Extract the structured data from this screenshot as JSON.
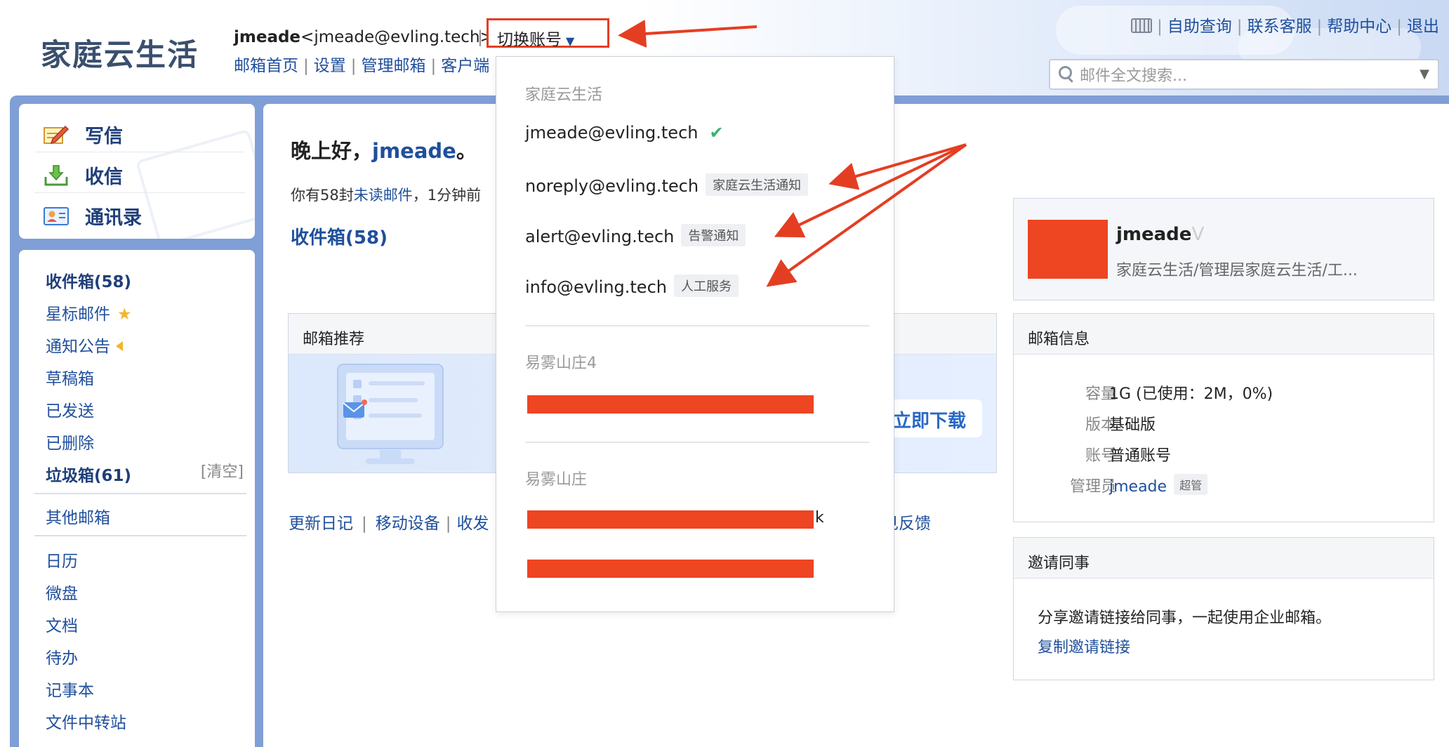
{
  "header": {
    "logo": "家庭云生活",
    "user_name": "jmeade",
    "user_email": "<jmeade@evling.tech>",
    "separator": "|",
    "switch_account": "切换账号",
    "nav": [
      "邮箱首页",
      "设置",
      "管理邮箱",
      "客户端"
    ],
    "right_links": [
      "自助查询",
      "联系客服",
      "帮助中心",
      "退出"
    ],
    "search_placeholder": "邮件全文搜索..."
  },
  "sidebar": {
    "quick": [
      {
        "label": "写信",
        "icon": "compose-icon"
      },
      {
        "label": "收信",
        "icon": "inbox-download-icon"
      },
      {
        "label": "通讯录",
        "icon": "contacts-icon"
      }
    ],
    "folders": [
      {
        "label": "收件箱(58)",
        "bold": true
      },
      {
        "label": "星标邮件",
        "icon": "star-icon"
      },
      {
        "label": "通知公告",
        "icon": "speaker-icon"
      },
      {
        "label": "草稿箱"
      },
      {
        "label": "已发送"
      },
      {
        "label": "已删除"
      },
      {
        "label": "垃圾箱(61)",
        "bold": true
      }
    ],
    "clear_trash": "[清空]",
    "other_mailbox": "其他邮箱",
    "apps": [
      "日历",
      "微盘",
      "文档",
      "待办",
      "记事本",
      "文件中转站"
    ]
  },
  "main": {
    "greeting_prefix": "晚上好，",
    "greeting_name": "jmeade",
    "greeting_suffix": "。",
    "unread_prefix": "你有58封",
    "unread_link": "未读邮件",
    "unread_suffix": "，1分钟前",
    "inbox_title": "收件箱(58)",
    "recommend_title": "邮箱推荐",
    "download_button": "立即下载",
    "bottom_links": [
      "更新日记",
      "移动设备",
      "收发"
    ],
    "feedback": "见反馈"
  },
  "profile": {
    "name": "jmeade",
    "name_suffix": "V",
    "dept": "家庭云生活/管理层家庭云生活/工..."
  },
  "mailbox_info": {
    "title": "邮箱信息",
    "rows": [
      {
        "label": "容量",
        "value": "1G (已使用：2M，0%)"
      },
      {
        "label": "版本",
        "value": "基础版"
      },
      {
        "label": "账号",
        "value": "普通账号"
      },
      {
        "label": "管理员",
        "value": "jmeade",
        "badge": "超管"
      }
    ]
  },
  "invite": {
    "title": "邀请同事",
    "text": "分享邀请链接给同事，一起使用企业邮箱。",
    "link": "复制邀请链接"
  },
  "dropdown": {
    "group1": "家庭云生活",
    "accounts": [
      {
        "email": "jmeade@evling.tech",
        "current": true,
        "check": "✔"
      },
      {
        "email": "noreply@evling.tech",
        "tag": "家庭云生活通知"
      },
      {
        "email": "alert@evling.tech",
        "tag": "告警通知"
      },
      {
        "email": "info@evling.tech",
        "tag": "人工服务"
      }
    ],
    "group2": "易雾山庄4",
    "group3": "易雾山庄",
    "stub_k": "k"
  },
  "colors": {
    "accent": "#1f4f9c",
    "frame": "#7f9fd6",
    "annotation_red": "#e43e22",
    "redaction": "#ee4523"
  }
}
